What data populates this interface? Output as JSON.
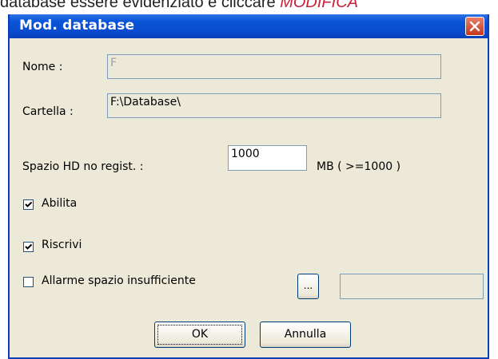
{
  "background_text": {
    "prefix": "database essere evidenziato e cliccare ",
    "highlight": "MODIFICA"
  },
  "dialog": {
    "title": "Mod. database",
    "close_icon": "close-icon",
    "fields": {
      "nome": {
        "label": "Nome :",
        "value": "F"
      },
      "cartella": {
        "label": "Cartella :",
        "value": "F:\\Database\\"
      },
      "spazio": {
        "label": "Spazio HD no regist. :",
        "value": "1000",
        "unit": "MB ( >=1000 )"
      }
    },
    "checkboxes": [
      {
        "label": "Abilita",
        "checked": true
      },
      {
        "label": "Riscrivi",
        "checked": true
      },
      {
        "label": "Allarme spazio insufficiente",
        "checked": false
      }
    ],
    "browse_button": "...",
    "alarm_value": "",
    "ok_label": "OK",
    "cancel_label": "Annulla"
  },
  "colors": {
    "title_bar": "#0a54d8",
    "dialog_bg": "#ece9d8",
    "highlight_text": "#c8203a"
  }
}
